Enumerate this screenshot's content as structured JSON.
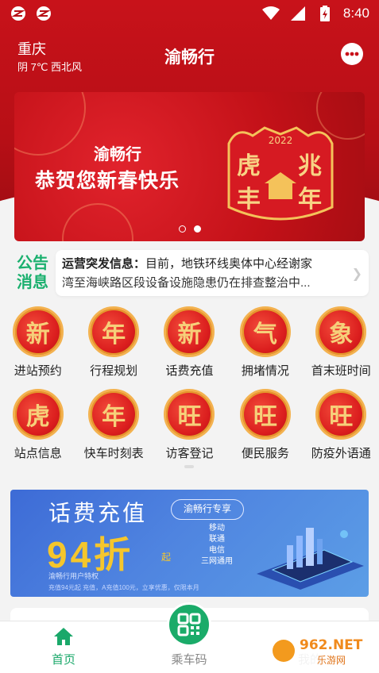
{
  "status_bar": {
    "time": "8:40"
  },
  "header": {
    "city": "重庆",
    "weather": "阴 7℃ 西北风",
    "title": "渝畅行"
  },
  "banner": {
    "line1": "渝畅行",
    "line2": "恭贺您新春快乐",
    "art_year": "2022",
    "art_text": [
      "虎",
      "兆",
      "丰",
      "年"
    ],
    "slides": 2,
    "active_slide": 2
  },
  "notice": {
    "badge_top": "公告",
    "badge_bottom": "消息",
    "label": "运营突发信息：",
    "text_line1": "目前，地铁环线奥体中心经谢家",
    "text_line2": "湾至海峡路区段设备设施隐患仍在排查整治中..."
  },
  "services": [
    {
      "glyph": "新",
      "label": "进站预约"
    },
    {
      "glyph": "年",
      "label": "行程规划"
    },
    {
      "glyph": "新",
      "label": "话费充值"
    },
    {
      "glyph": "气",
      "label": "拥堵情况"
    },
    {
      "glyph": "象",
      "label": "首末班时间"
    },
    {
      "glyph": "虎",
      "label": "站点信息"
    },
    {
      "glyph": "年",
      "label": "快车时刻表"
    },
    {
      "glyph": "旺",
      "label": "访客登记"
    },
    {
      "glyph": "旺",
      "label": "便民服务"
    },
    {
      "glyph": "旺",
      "label": "防疫外语通"
    }
  ],
  "ad": {
    "title": "话费充值",
    "tag": "渝畅行专享",
    "discount": "94折",
    "suffix": "起",
    "networks": [
      "移动",
      "联通",
      "电信",
      "三网通用"
    ],
    "subtitle": "渝畅行用户特权",
    "fine_print": "充值94元起 充值，A充值100元，立享优惠，仅限本月"
  },
  "nav": {
    "home": "首页",
    "ride": "乘车码",
    "mine": "我的"
  },
  "watermark": {
    "brand": "962.NET",
    "sub": "乐游网"
  },
  "colors": {
    "brand_red": "#c8121a",
    "accent_green": "#1aab69",
    "gold": "#f5c62c"
  }
}
